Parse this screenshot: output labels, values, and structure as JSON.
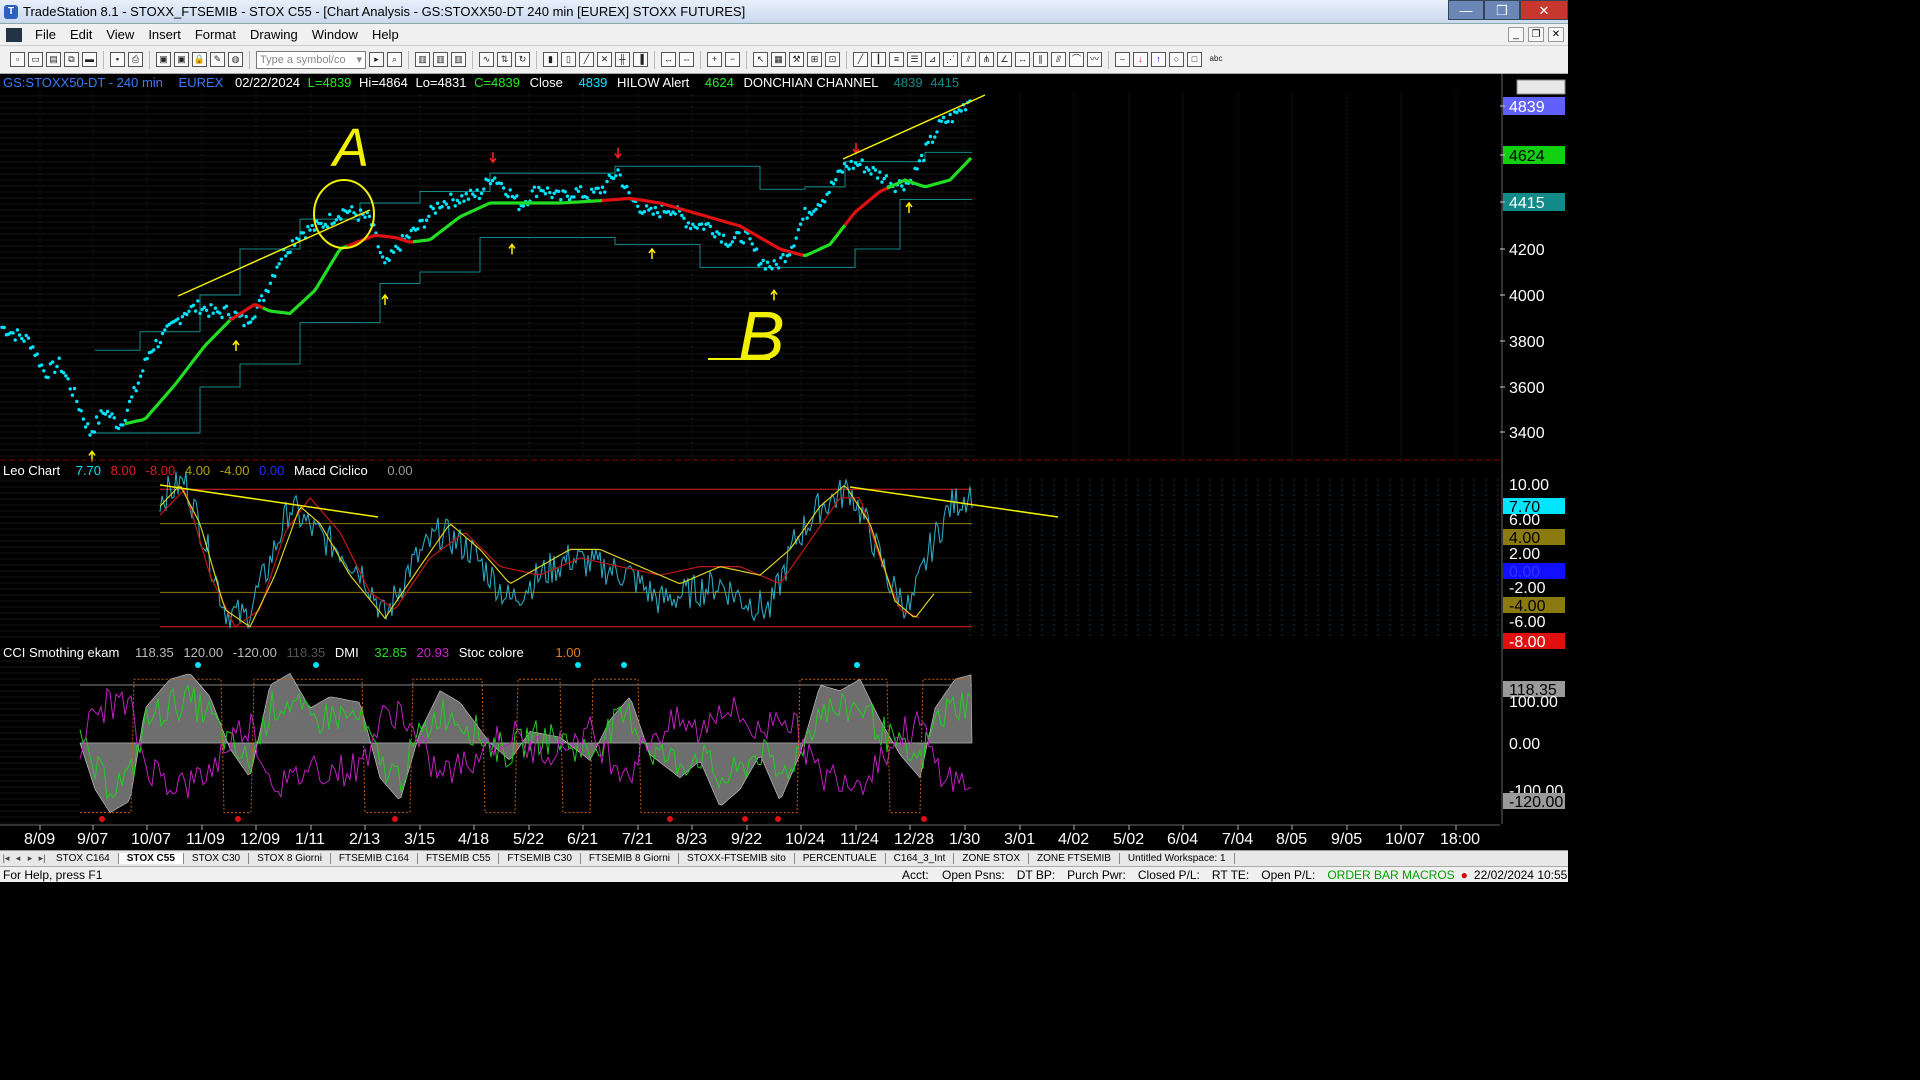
{
  "window": {
    "title": "TradeStation 8.1 - STOXX_FTSEMIB - STOX C55 - [Chart Analysis - GS:STOXX50-DT  240 min  [EUREX] STOXX FUTURES]",
    "min_glyph": "—",
    "max_glyph": "❒",
    "close_glyph": "✕"
  },
  "menu": [
    "File",
    "Edit",
    "View",
    "Insert",
    "Format",
    "Drawing",
    "Window",
    "Help"
  ],
  "toolbar": {
    "symbol_placeholder": "Type a symbol/co",
    "abc_label": "abc"
  },
  "price_panel": {
    "symbol": "GS:STOXX50-DT - 240 min",
    "exchange": "EUREX",
    "date": "02/22/2024",
    "last": "L=4839",
    "hi": "Hi=4864",
    "lo": "Lo=4831",
    "close_val": "C=4839",
    "close_label": "Close",
    "close_num": "4839",
    "hilow_label": "HILOW Alert",
    "hilow_val": "4624",
    "donchian_label": "DONCHIAN CHANNEL",
    "donchian_up": "4839",
    "donchian_lo": "4415",
    "y_ticks": [
      "4839",
      "4624",
      "4415",
      "4200",
      "4000",
      "3800",
      "3600",
      "3400"
    ],
    "annotations": [
      "A",
      "B"
    ]
  },
  "osc_panel": {
    "label": "Leo Chart",
    "v1": "7.70",
    "v2": "8.00",
    "v3": "-8.00",
    "v4": "4.00",
    "v5": "-4.00",
    "v6": "0.00",
    "macd_label": "Macd Ciclico",
    "macd_val": "0.00",
    "y_ticks": [
      "10.00",
      "7.70",
      "6.00",
      "4.00",
      "2.00",
      "0.00",
      "-2.00",
      "-4.00",
      "-6.00",
      "-8.00"
    ]
  },
  "cci_panel": {
    "label": "CCI Smothing ekam",
    "v1": "118.35",
    "v2": "120.00",
    "v3": "-120.00",
    "v4": "118.35",
    "dmi_label": "DMI",
    "dmi1": "32.85",
    "dmi2": "20.93",
    "stoc_label": "Stoc colore",
    "stoc_val": "1.00",
    "y_ticks": [
      "118.35",
      "100.00",
      "0.00",
      "-100.00",
      "-120.00"
    ]
  },
  "x_axis": [
    "8/09",
    "9/07",
    "10/07",
    "11/09",
    "12/09",
    "1/11",
    "2/13",
    "3/15",
    "4/18",
    "5/22",
    "6/21",
    "7/21",
    "8/23",
    "9/22",
    "10/24",
    "11/24",
    "12/28",
    "1/30",
    "3/01",
    "4/02",
    "5/02",
    "6/04",
    "7/04",
    "8/05",
    "9/05",
    "10/07",
    "18:00"
  ],
  "tabs": [
    "STOX C164",
    "STOX C55",
    "STOX C30",
    "STOX 8 Giorni",
    "FTSEMIB C164",
    "FTSEMIB C55",
    "FTSEMIB C30",
    "FTSEMIB 8 Giorni",
    "STOXX-FTSEMIB sito",
    "PERCENTUALE",
    "C164_3_Int",
    "ZONE STOX",
    "ZONE FTSEMIB",
    "Untitled Workspace: 1"
  ],
  "status": {
    "help": "For Help, press F1",
    "acct": "Acct:",
    "open_psns": "Open Psns:",
    "dt_bp": "DT BP:",
    "purch_pwr": "Purch Pwr:",
    "closed_pl": "Closed P/L:",
    "rt_te": "RT TE:",
    "open_pl": "Open P/L:",
    "macros": "ORDER BAR MACROS",
    "datetime": "22/02/2024 10:55"
  },
  "colors": {
    "price": "#00e5ff",
    "ma_up": "#22dd22",
    "ma_down": "#e01010",
    "trendline": "#f0f000",
    "channel": "#138a8a",
    "cci_fill": "#6e6e6e",
    "dmi_plus": "#22cc22",
    "dmi_minus": "#c020c0"
  }
}
